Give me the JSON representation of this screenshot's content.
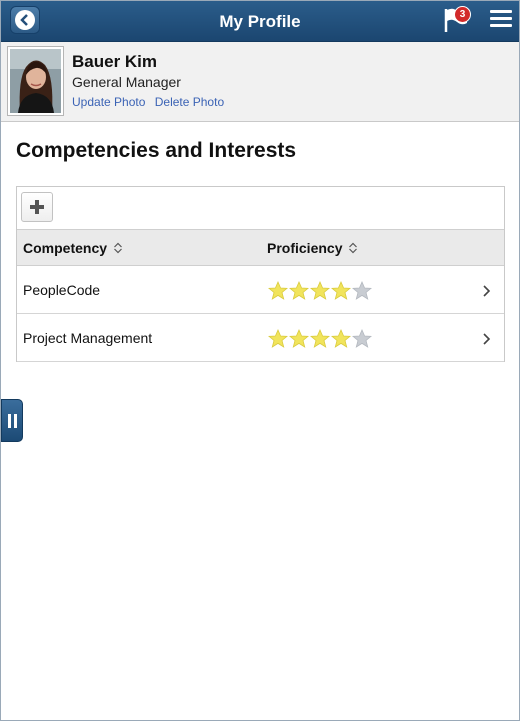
{
  "header": {
    "title": "My Profile",
    "notification_count": "3",
    "back_icon": "back-arrow-icon",
    "flag_icon": "flag-icon",
    "menu_icon": "hamburger-menu-icon"
  },
  "profile": {
    "name": "Bauer Kim",
    "job_title": "General Manager",
    "update_photo": "Update Photo",
    "delete_photo": "Delete Photo"
  },
  "section": {
    "title": "Competencies and Interests"
  },
  "grid": {
    "columns": [
      "Competency",
      "Proficiency"
    ],
    "rows": [
      {
        "competency": "PeopleCode",
        "proficiency_rating": 4,
        "proficiency_max": 5
      },
      {
        "competency": "Project Management",
        "proficiency_rating": 4,
        "proficiency_max": 5
      }
    ]
  },
  "colors": {
    "header": "#1f4f7c",
    "star_filled": "#f1e45c",
    "star_empty": "#c8ccd2",
    "link": "#3b63b5"
  }
}
